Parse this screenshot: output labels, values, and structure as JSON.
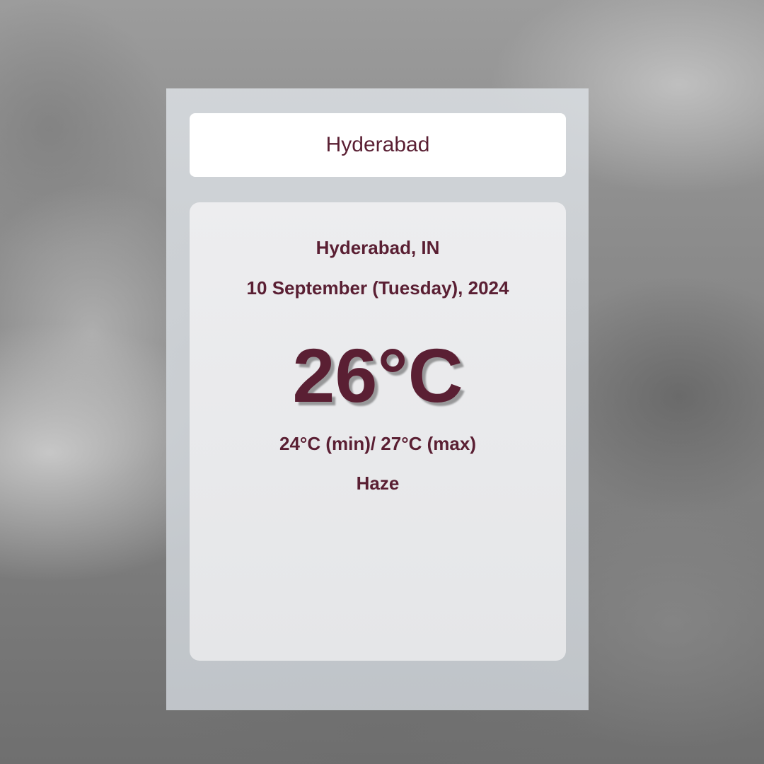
{
  "theme": {
    "text_color": "#5a1f33",
    "panel_color": "#d4d8dc",
    "card_color": "#ececee"
  },
  "search": {
    "value": "Hyderabad"
  },
  "weather": {
    "location": "Hyderabad, IN",
    "date": "10 September (Tuesday), 2024",
    "temperature": "26°C",
    "range": "24°C (min)/ 27°C (max)",
    "condition": "Haze"
  }
}
